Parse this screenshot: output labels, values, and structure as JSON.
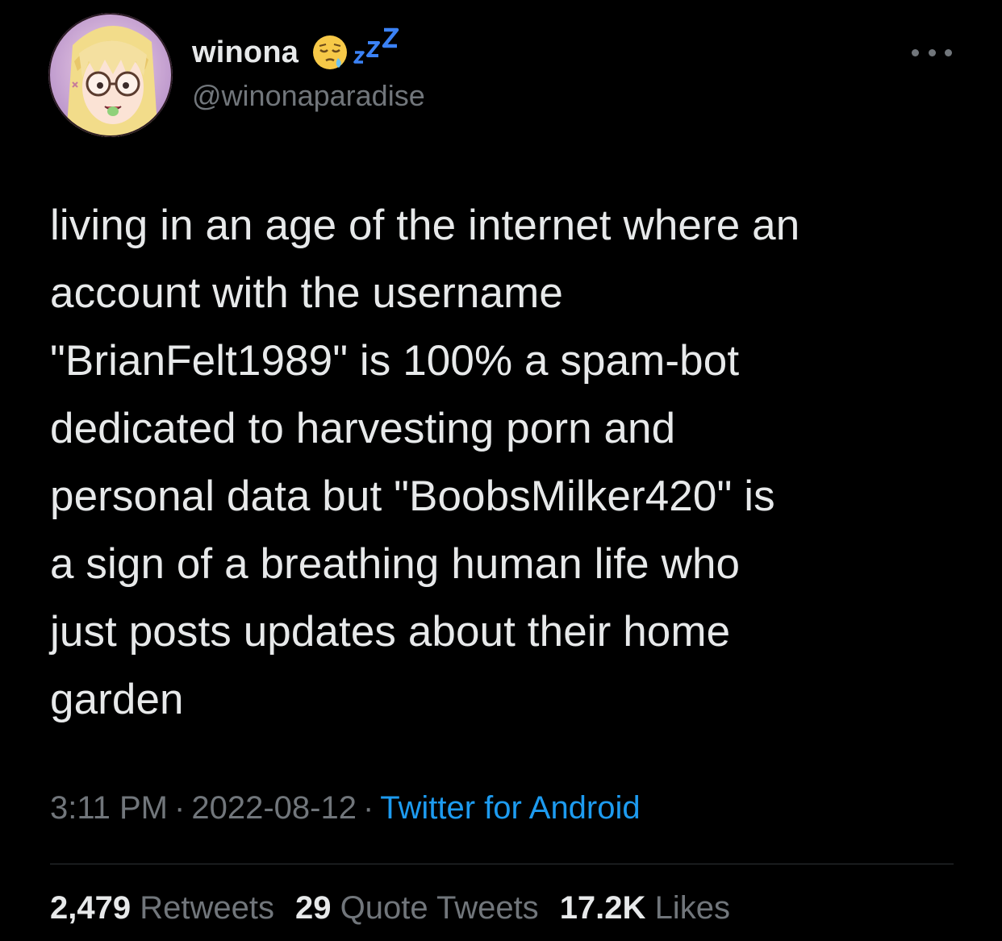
{
  "tweet": {
    "author": {
      "display_name": "winona",
      "handle": "@winonaparadise",
      "name_emojis": [
        "sleepy-face-emoji",
        "zzz-emoji"
      ]
    },
    "text": "living in an age of the internet where an\naccount with the username\n\"BrianFelt1989\" is 100% a spam-bot\ndedicated to harvesting porn and\npersonal data but \"BoobsMilker420\" is\na sign of a breathing human life who\njust posts updates about their home\ngarden",
    "time": "3:11 PM",
    "date": "2022-08-12",
    "separator": "·",
    "source": "Twitter for Android",
    "stats": {
      "retweets_count": "2,479",
      "retweets_label": "Retweets",
      "quotes_count": "29",
      "quotes_label": "Quote Tweets",
      "likes_count": "17.2K",
      "likes_label": "Likes"
    }
  },
  "colors": {
    "background": "#000000",
    "primary_text": "#e7e9ea",
    "secondary_text": "#71767b",
    "link": "#1d9bf0",
    "divider": "#2f3336"
  }
}
